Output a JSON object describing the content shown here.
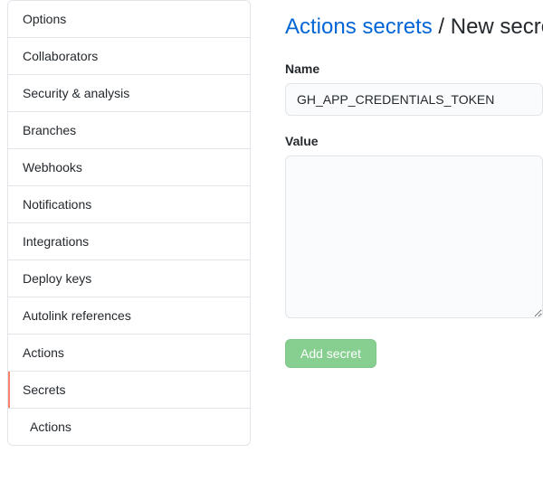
{
  "sidebar": {
    "items": [
      {
        "label": "Options",
        "active": false
      },
      {
        "label": "Collaborators",
        "active": false
      },
      {
        "label": "Security & analysis",
        "active": false
      },
      {
        "label": "Branches",
        "active": false
      },
      {
        "label": "Webhooks",
        "active": false
      },
      {
        "label": "Notifications",
        "active": false
      },
      {
        "label": "Integrations",
        "active": false
      },
      {
        "label": "Deploy keys",
        "active": false
      },
      {
        "label": "Autolink references",
        "active": false
      },
      {
        "label": "Actions",
        "active": false
      },
      {
        "label": "Secrets",
        "active": true
      },
      {
        "label": "Actions",
        "active": false,
        "sub": true
      }
    ]
  },
  "heading": {
    "link_text": "Actions secrets",
    "separator": " / ",
    "subtitle": "New secret"
  },
  "form": {
    "name_label": "Name",
    "name_value": "GH_APP_CREDENTIALS_TOKEN",
    "value_label": "Value",
    "value_value": "",
    "submit_label": "Add secret"
  }
}
